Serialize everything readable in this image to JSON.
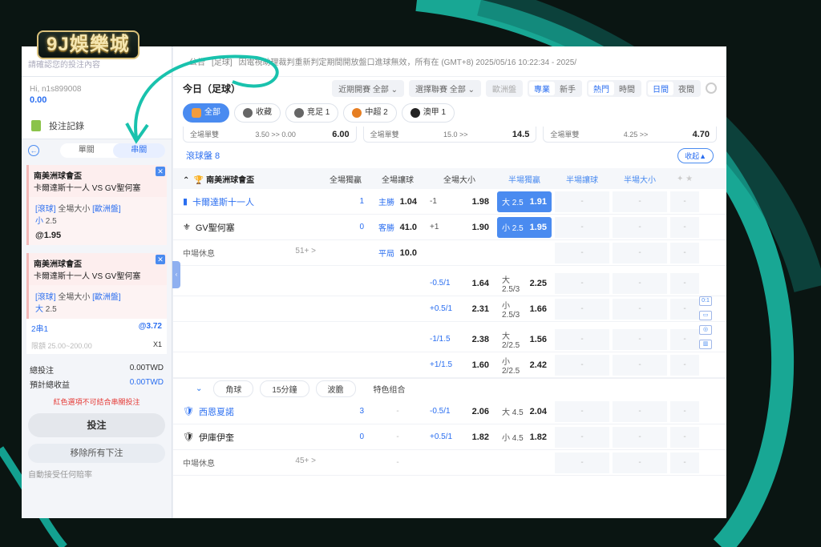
{
  "brand": {
    "logo_text": "9J娛樂城"
  },
  "left": {
    "notice": "請確認您的投注內容",
    "user": "Hi, n1s899008",
    "balance": "0.00",
    "bet_record": "投注記錄",
    "tab_single": "單關",
    "tab_parlay": "串關",
    "slips": [
      {
        "league": "南美洲球會盃",
        "match": "卡爾達斯十一人  VS  GV聖何塞",
        "type": "[滾球]",
        "market": "全場大小",
        "odds_type": "[歐洲盤]",
        "pick": "小",
        "line": "2.5",
        "odds": "@1.95"
      },
      {
        "league": "南美洲球會盃",
        "match": "卡爾達斯十一人  VS  GV聖何塞",
        "type": "[滾球]",
        "market": "全場大小",
        "odds_type": "[歐洲盤]",
        "pick": "大",
        "line": "2.5",
        "odds": ""
      }
    ],
    "parlay_label": "2串1",
    "parlay_odds": "@3.72",
    "limit": "限額 25.00~200.00",
    "multiplier": "X1",
    "total_stake_label": "總投注",
    "total_stake": "0.00TWD",
    "est_win_label": "預計總收益",
    "est_win": "0.00TWD",
    "warning": "紅色選項不可結合串關投注",
    "bet_button": "投注",
    "remove_button": "移除所有下注",
    "auto_accept": "自動接受任何賠率"
  },
  "main": {
    "notice_tag": "公告",
    "notice_cat": "[足球]",
    "notice_text": "因電視助理裁判重新判定期間開放盤口進球無效，所有在 (GMT+8) 2025/05/16 10:22:34 - 2025/",
    "title": "今日（足球）",
    "recent_label": "近期開賽",
    "recent_value": "全部",
    "league_label": "選擇聯賽",
    "league_value": "全部",
    "odds_type": "歐洲盤",
    "mode_pro": "專業",
    "mode_new": "新手",
    "sort_hot": "熱門",
    "sort_time": "時間",
    "day": "日間",
    "night": "夜間",
    "chips": [
      {
        "label": "全部"
      },
      {
        "label": "收藏"
      },
      {
        "label": "竞足 1"
      },
      {
        "label": "中超 2"
      },
      {
        "label": "澳甲 1"
      }
    ],
    "prev": [
      {
        "label": "全場單雙",
        "vals": "3.50 >> 0.00",
        "odd": "6.00"
      },
      {
        "label": "全場單雙",
        "vals": "15.0 >>",
        "odd": "14.5"
      },
      {
        "label": "全場單雙",
        "vals": "4.25 >>",
        "odd": "4.70"
      }
    ],
    "section": "滾球盤 8",
    "collapse": "收起▲",
    "cols": {
      "league": "南美洲球會盃",
      "c1": "全場獨贏",
      "c2": "全場讓球",
      "c3": "全場大小",
      "c4": "半場獨贏",
      "c5": "半場讓球",
      "c6": "半場大小"
    },
    "match1": {
      "home": "卡爾達斯十一人",
      "home_score": "1",
      "away": "GV聖何塞",
      "away_score": "0",
      "status": "中場休息",
      "more": "51+ >",
      "ml_home_l": "主勝",
      "ml_home": "1.04",
      "ml_away_l": "客勝",
      "ml_away": "41.0",
      "ml_draw_l": "平局",
      "ml_draw": "10.0",
      "hc1_h": "-1",
      "hc1_o": "1.98",
      "hc2_h": "+1",
      "hc2_o": "1.90",
      "ou1_h": "大 2.5",
      "ou1_o": "1.91",
      "ou2_h": "小 2.5",
      "ou2_o": "1.95",
      "alt": [
        {
          "hc_h": "-0.5/1",
          "hc_o": "1.64",
          "ou_h": "大 2.5/3",
          "ou_o": "2.25"
        },
        {
          "hc_h": "+0.5/1",
          "hc_o": "2.31",
          "ou_h": "小 2.5/3",
          "ou_o": "1.66"
        },
        {
          "hc_h": "-1/1.5",
          "hc_o": "2.38",
          "ou_h": "大 2/2.5",
          "ou_o": "1.56"
        },
        {
          "hc_h": "+1/1.5",
          "hc_o": "1.60",
          "ou_h": "小 2/2.5",
          "ou_o": "2.42"
        }
      ]
    },
    "subtabs": [
      "角球",
      "15分鐘",
      "波膽",
      "特色组合"
    ],
    "match2": {
      "home": "西恩夏諾",
      "home_score": "3",
      "away": "伊庫伊奎",
      "away_score": "0",
      "status": "中場休息",
      "more": "45+ >",
      "hc1_h": "-0.5/1",
      "hc1_o": "2.06",
      "hc2_h": "+0.5/1",
      "hc2_o": "1.82",
      "ou1_h": "大 4.5",
      "ou1_o": "2.04",
      "ou2_h": "小 4.5",
      "ou2_o": "1.82"
    },
    "dash": "-"
  }
}
